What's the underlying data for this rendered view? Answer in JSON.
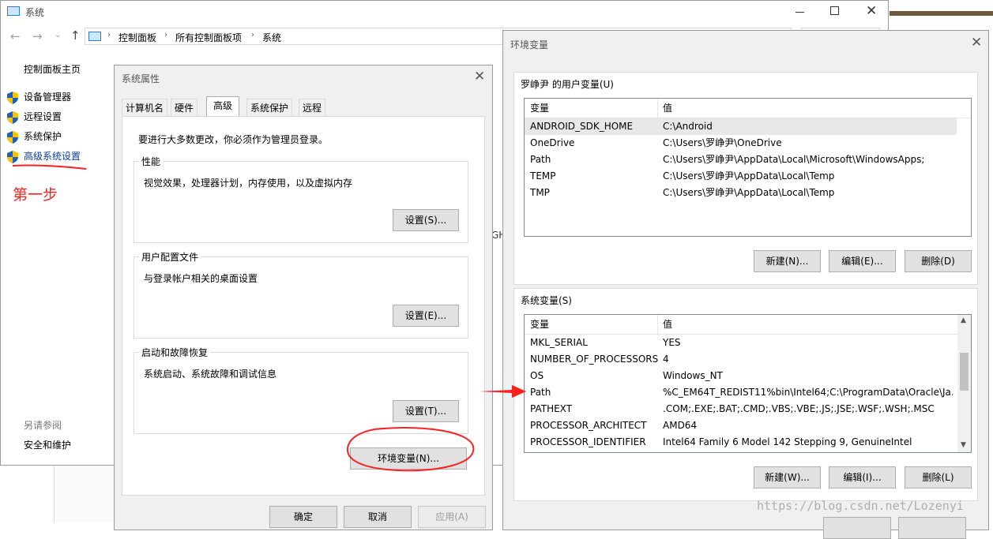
{
  "colors": {
    "annotation_red": "#ff2020",
    "link_blue": "#0b3e9a",
    "selected_row": "#e8e8e8"
  },
  "system_window": {
    "title": "系统",
    "breadcrumb": [
      "控制面板",
      "所有控制面板项",
      "系统"
    ],
    "sidebar": {
      "home": "控制面板主页",
      "items": [
        {
          "label": "设备管理器",
          "icon": "shield-icon"
        },
        {
          "label": "远程设置",
          "icon": "shield-icon"
        },
        {
          "label": "系统保护",
          "icon": "shield-icon"
        },
        {
          "label": "高级系统设置",
          "icon": "shield-icon"
        }
      ],
      "see_also": "另请参阅",
      "security": "安全和维护"
    },
    "partial_text": "GH",
    "annotation": "第一步"
  },
  "properties_dialog": {
    "title": "系统属性",
    "tabs": [
      "计算机名",
      "硬件",
      "高级",
      "系统保护",
      "远程"
    ],
    "active_tab": "高级",
    "admin_note": "要进行大多数更改，你必须作为管理员登录。",
    "groups": [
      {
        "title": "性能",
        "desc": "视觉效果，处理器计划，内存使用，以及虚拟内存",
        "button": "设置(S)..."
      },
      {
        "title": "用户配置文件",
        "desc": "与登录帐户相关的桌面设置",
        "button": "设置(E)..."
      },
      {
        "title": "启动和故障恢复",
        "desc": "系统启动、系统故障和调试信息",
        "button": "设置(T)..."
      }
    ],
    "env_button": "环境变量(N)...",
    "ok": "确定",
    "cancel": "取消",
    "apply": "应用(A)"
  },
  "env_dialog": {
    "title": "环境变量",
    "user_section": {
      "title": "罗峥尹 的用户变量(U)",
      "headers": [
        "变量",
        "值"
      ],
      "rows": [
        {
          "name": "ANDROID_SDK_HOME",
          "value": "C:\\Android"
        },
        {
          "name": "OneDrive",
          "value": "C:\\Users\\罗峥尹\\OneDrive"
        },
        {
          "name": "Path",
          "value": "C:\\Users\\罗峥尹\\AppData\\Local\\Microsoft\\WindowsApps;"
        },
        {
          "name": "TEMP",
          "value": "C:\\Users\\罗峥尹\\AppData\\Local\\Temp"
        },
        {
          "name": "TMP",
          "value": "C:\\Users\\罗峥尹\\AppData\\Local\\Temp"
        }
      ],
      "buttons": [
        "新建(N)...",
        "编辑(E)...",
        "删除(D)"
      ]
    },
    "system_section": {
      "title": "系统变量(S)",
      "headers": [
        "变量",
        "值"
      ],
      "rows": [
        {
          "name": "MKL_SERIAL",
          "value": "YES"
        },
        {
          "name": "NUMBER_OF_PROCESSORS",
          "value": "4"
        },
        {
          "name": "OS",
          "value": "Windows_NT"
        },
        {
          "name": "Path",
          "value": "%C_EM64T_REDIST11%bin\\Intel64;C:\\ProgramData\\Oracle\\Ja..."
        },
        {
          "name": "PATHEXT",
          "value": ".COM;.EXE;.BAT;.CMD;.VBS;.VBE;.JS;.JSE;.WSF;.WSH;.MSC"
        },
        {
          "name": "PROCESSOR_ARCHITECT",
          "value": "AMD64"
        },
        {
          "name": "PROCESSOR_IDENTIFIER",
          "value": "Intel64 Family 6 Model 142 Stepping 9, GenuineIntel"
        }
      ],
      "buttons": [
        "新建(W)...",
        "编辑(I)...",
        "删除(L)"
      ]
    }
  },
  "watermark": "https://blog.csdn.net/Lozenyi"
}
